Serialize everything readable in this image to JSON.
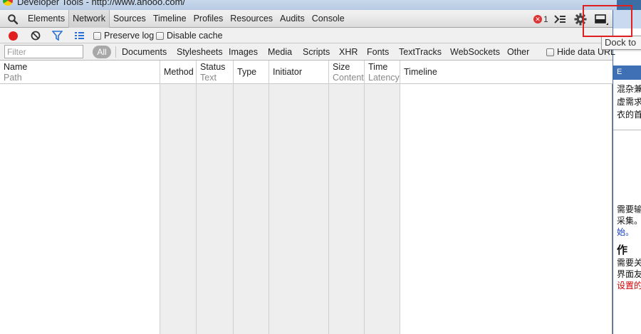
{
  "window": {
    "title": "Developer Tools - http://www.ahooo.com/"
  },
  "toolbar": {
    "search_icon": "magnifier-icon",
    "tabs": [
      {
        "label": "Elements",
        "selected": false
      },
      {
        "label": "Network",
        "selected": true
      },
      {
        "label": "Sources",
        "selected": false
      },
      {
        "label": "Timeline",
        "selected": false
      },
      {
        "label": "Profiles",
        "selected": false
      },
      {
        "label": "Resources",
        "selected": false
      },
      {
        "label": "Audits",
        "selected": false
      },
      {
        "label": "Console",
        "selected": false
      }
    ],
    "error_count": "1",
    "error_badge_glyph": "✕"
  },
  "network": {
    "preserve_log_label": "Preserve log",
    "disable_cache_label": "Disable cache",
    "filter_placeholder": "Filter",
    "all_label": "All",
    "filter_types": [
      "Documents",
      "Stylesheets",
      "Images",
      "Media",
      "Scripts",
      "XHR",
      "Fonts",
      "TextTracks",
      "WebSockets",
      "Other"
    ],
    "hide_data_url_label": "Hide data URL",
    "columns": [
      {
        "line1": "Name",
        "line2": "Path"
      },
      {
        "line1": "Method",
        "line2": ""
      },
      {
        "line1": "Status",
        "line2": "Text"
      },
      {
        "line1": "Type",
        "line2": ""
      },
      {
        "line1": "Initiator",
        "line2": ""
      },
      {
        "line1": "Size",
        "line2": "Content"
      },
      {
        "line1": "Time",
        "line2": "Latency"
      },
      {
        "line1": "Timeline",
        "line2": ""
      }
    ]
  },
  "tooltip": {
    "text": "Dock to"
  },
  "background_page": {
    "heading_glyph": "E",
    "lines_a": [
      "混杂兼",
      "虚需求",
      "衣的首"
    ],
    "lines_b": [
      "需要输",
      "采集。",
      "始。"
    ],
    "heading2": "作",
    "lines_c": [
      "需要关",
      "界面友",
      "设置的"
    ]
  },
  "colors": {
    "accent_red": "#e02020",
    "link_blue": "#1a3fbf",
    "warning_red": "#cc0000"
  }
}
